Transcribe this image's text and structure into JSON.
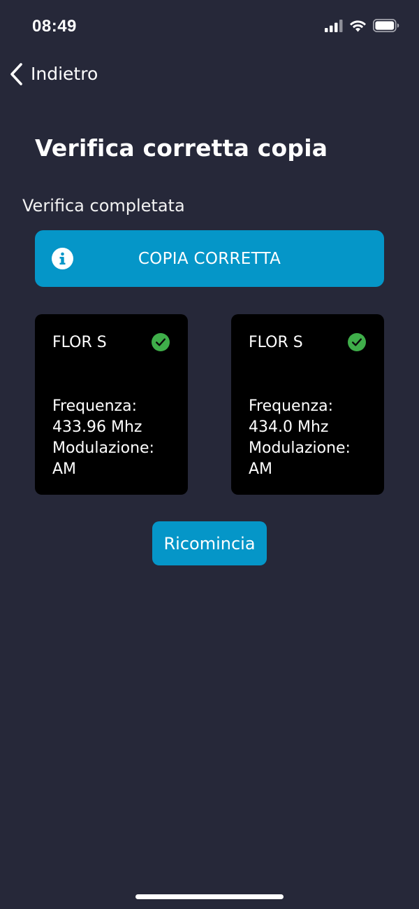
{
  "status_bar": {
    "time": "08:49",
    "icons": [
      "cellular-signal-icon",
      "wifi-icon",
      "battery-icon"
    ]
  },
  "nav": {
    "back_label": "Indietro"
  },
  "page": {
    "title": "Verifica corretta copia",
    "section_label": "Verifica completata"
  },
  "banner": {
    "text": "COPIA CORRETTA",
    "icon": "info-icon",
    "color": "#0596c8"
  },
  "cards": [
    {
      "title": "FLOR S",
      "status_icon": "check-circle-icon",
      "frequency_label": "Frequenza:",
      "frequency_value": "433.96 Mhz",
      "modulation_label": "Modulazione:",
      "modulation_value": "AM"
    },
    {
      "title": "FLOR S",
      "status_icon": "check-circle-icon",
      "frequency_label": "Frequenza:",
      "frequency_value": "434.0 Mhz",
      "modulation_label": "Modulazione:",
      "modulation_value": "AM"
    }
  ],
  "actions": {
    "restart_label": "Ricomincia"
  },
  "colors": {
    "background": "#262839",
    "accent": "#0596c8",
    "success": "#3fae4a",
    "card_background": "#000000"
  }
}
